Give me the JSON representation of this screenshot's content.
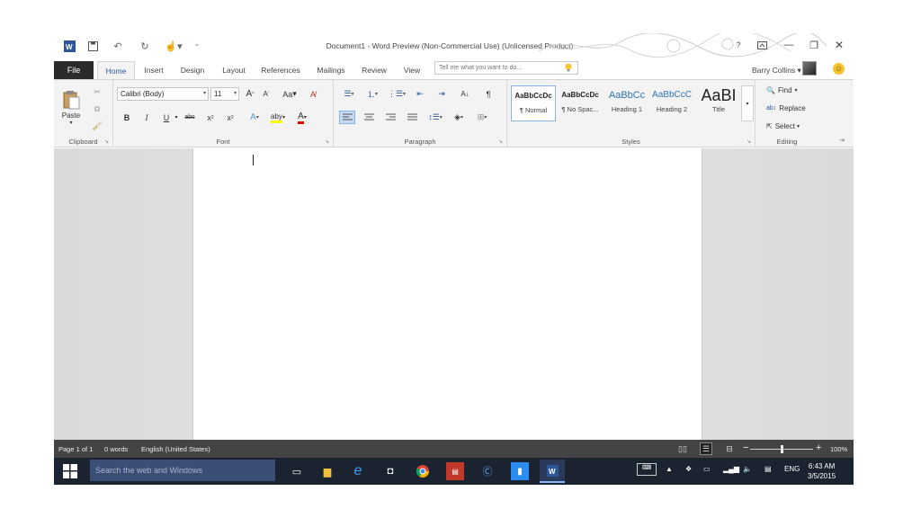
{
  "title_bar": {
    "doc_title": "Document1 - Word Preview (Non-Commercial Use) (Unlicensed Product)",
    "help": "?"
  },
  "tabs": {
    "file": "File",
    "items": [
      "Home",
      "Insert",
      "Design",
      "Layout",
      "References",
      "Mailings",
      "Review",
      "View"
    ],
    "active": "Home"
  },
  "tell_me": {
    "placeholder": "Tell me what you want to do..."
  },
  "user": {
    "name": "Barry Collins"
  },
  "ribbon": {
    "clipboard": {
      "label": "Clipboard",
      "paste": "Paste"
    },
    "font": {
      "label": "Font",
      "font_name": "Calibri (Body)",
      "font_size": "11",
      "change_case": "Aa",
      "bold": "B",
      "italic": "I",
      "underline": "U",
      "strike": "abc",
      "subscript": "x",
      "superscript": "x",
      "highlight": "aby",
      "color": "A"
    },
    "paragraph": {
      "label": "Paragraph"
    },
    "styles": {
      "label": "Styles",
      "items": [
        {
          "sample": "AaBbCcDc",
          "name": "¶ Normal"
        },
        {
          "sample": "AaBbCcDc",
          "name": "¶ No Spac..."
        },
        {
          "sample": "AaBbCc",
          "name": "Heading 1"
        },
        {
          "sample": "AaBbCcC",
          "name": "Heading 2"
        },
        {
          "sample": "AaBI",
          "name": "Title"
        }
      ]
    },
    "editing": {
      "label": "Editing",
      "find": "Find",
      "replace": "Replace",
      "select": "Select"
    }
  },
  "status": {
    "page": "Page 1 of 1",
    "words": "0 words",
    "language": "English (United States)",
    "zoom": "100%",
    "zoom_minus": "−",
    "zoom_plus": "+"
  },
  "taskbar": {
    "search_placeholder": "Search the web and Windows",
    "lang": "ENG",
    "time": "6:43 AM",
    "date": "3/5/2015"
  },
  "colors": {
    "word_blue": "#2b579a",
    "statusbar": "#444444",
    "taskbar": "#1b2330"
  }
}
